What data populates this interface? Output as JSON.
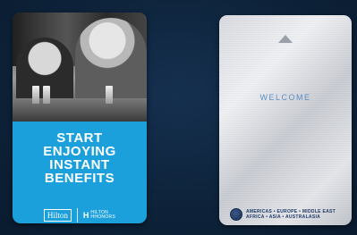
{
  "left_card": {
    "headline": [
      "START",
      "ENJOYING",
      "INSTANT",
      "BENEFITS"
    ],
    "brand": "Hilton",
    "program_mark": "H",
    "program_name": [
      "HILTON",
      "HHONORS"
    ],
    "colors": {
      "panel": "#1ba0db",
      "text": "#ffffff"
    }
  },
  "right_card": {
    "welcome_text": "WELCOME",
    "regions": [
      "AMERICAS • EUROPE • MIDDLE EAST",
      "AFRICA • ASIA • AUSTRALASIA"
    ],
    "colors": {
      "welcome": "#5b8ec4",
      "regions": "#1f3a66"
    }
  },
  "icons": [
    "triangle-down-icon",
    "triangle-up-icon",
    "globe-icon"
  ]
}
